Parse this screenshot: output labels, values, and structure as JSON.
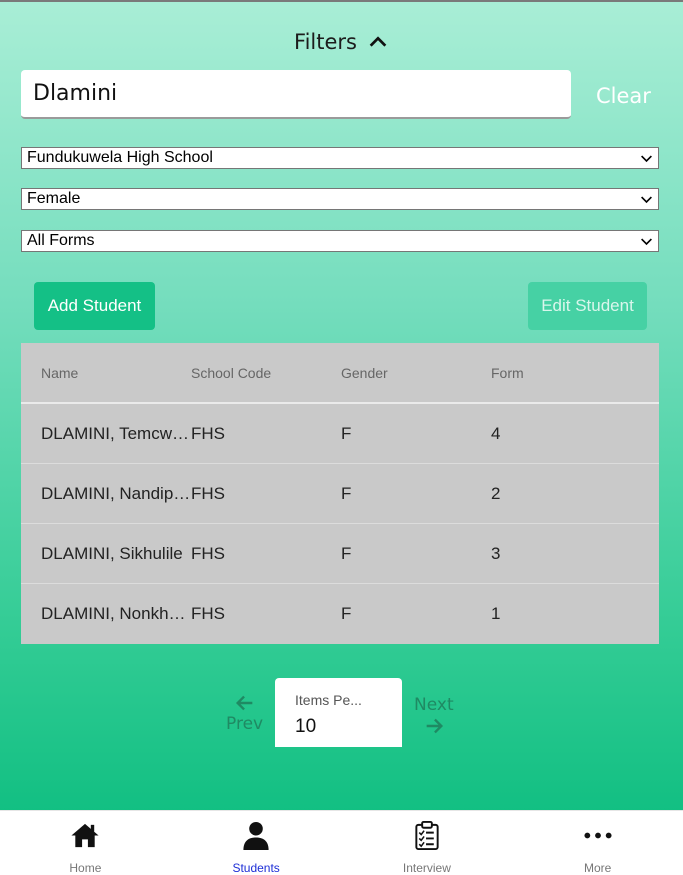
{
  "filters": {
    "title": "Filters"
  },
  "search": {
    "value": "Dlamini"
  },
  "clear_label": "Clear",
  "selects": {
    "school": "Fundukuwela High School",
    "gender": "Female",
    "form": "All Forms"
  },
  "actions": {
    "add": "Add Student",
    "edit": "Edit Student"
  },
  "table": {
    "headers": [
      "Name",
      "School Code",
      "Gender",
      "Form"
    ],
    "rows": [
      [
        "DLAMINI, Temcwasi",
        "FHS",
        "F",
        "4"
      ],
      [
        "DLAMINI, Nandipha",
        "FHS",
        "F",
        "2"
      ],
      [
        "DLAMINI, Sikhulile",
        "FHS",
        "F",
        "3"
      ],
      [
        "DLAMINI, Nonkhululeko",
        "FHS",
        "F",
        "1"
      ]
    ]
  },
  "pagination": {
    "prev": "Prev",
    "next": "Next",
    "items_per_page_label": "Items Pe...",
    "items_per_page_value": "10"
  },
  "tabbar": {
    "home": "Home",
    "students": "Students",
    "interview": "Interview",
    "more": "More"
  },
  "colors": {
    "accent": "#14c086",
    "active_tab": "#1d2ed6"
  }
}
